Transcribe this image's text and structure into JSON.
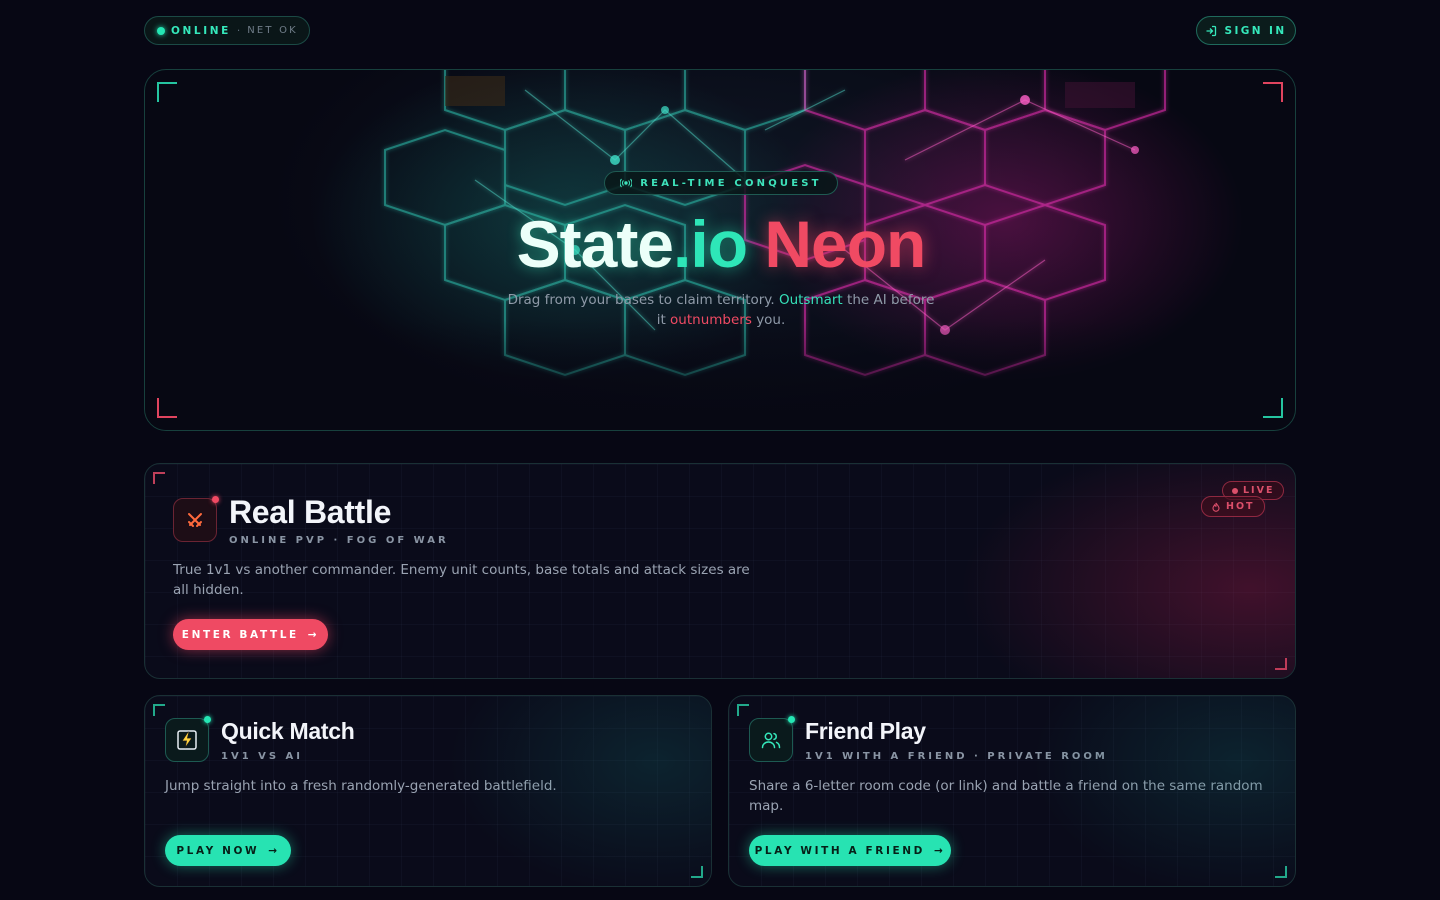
{
  "status": {
    "online_label": "ONLINE",
    "separator": "·",
    "net_label": "NET OK"
  },
  "signin": {
    "label": "SIGN IN",
    "icon": "login-icon"
  },
  "hero": {
    "tag_label": "REAL-TIME CONQUEST",
    "tag_icon": "broadcast-icon",
    "title_state": "State",
    "title_io": ".io",
    "title_neon": "Neon",
    "subtitle_before": "Drag from your bases to claim territory.",
    "subtitle_hl1": "Outsmart",
    "subtitle_mid": "the AI before it",
    "subtitle_hl2": "outnumbers",
    "subtitle_after": "you."
  },
  "modes": {
    "battle": {
      "title": "Real Battle",
      "subtitle": "ONLINE PVP · FOG OF WAR",
      "description": "True 1v1 vs another commander. Enemy unit counts, base totals and attack sizes are all hidden.",
      "button": "ENTER BATTLE",
      "badge_live": "LIVE",
      "badge_hot": "HOT",
      "icon": "crossed-swords-icon"
    },
    "quick": {
      "title": "Quick Match",
      "subtitle": "1V1 VS AI",
      "description": "Jump straight into a fresh randomly-generated battlefield.",
      "button": "PLAY NOW",
      "icon": "lightning-icon"
    },
    "friend": {
      "title": "Friend Play",
      "subtitle": "1V1 WITH A FRIEND · PRIVATE ROOM",
      "description": "Share a 6-letter room code (or link) and battle a friend on the same random map.",
      "button": "PLAY WITH A FRIEND",
      "icon": "users-icon"
    }
  },
  "colors": {
    "teal": "#27e3b2",
    "red": "#ef4a63",
    "background": "#070714"
  }
}
